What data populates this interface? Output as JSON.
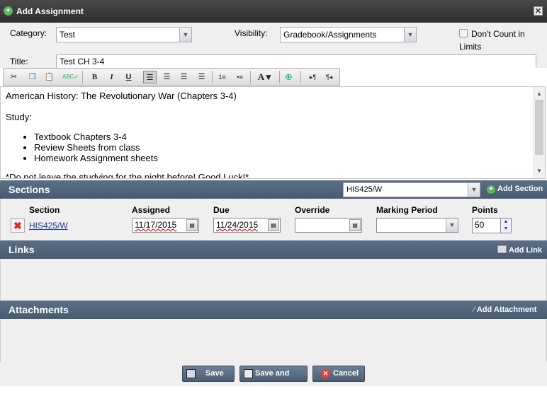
{
  "dialog": {
    "title": "Add Assignment",
    "close_icon": "close-icon"
  },
  "form": {
    "category_label": "Category:",
    "category_value": "Test",
    "visibility_label": "Visibility:",
    "visibility_value": "Gradebook/Assignments",
    "dont_count_label_1": "Don't Count in",
    "dont_count_label_2": "Limits",
    "title_label": "Title:",
    "title_value": "Test CH 3-4"
  },
  "editor": {
    "line1": "American History: The Revolutionary War (Chapters 3-4)",
    "line2": "Study:",
    "bullets": [
      "Textbook Chapters 3-4",
      "Review Sheets from class",
      "Homework Assignment sheets"
    ],
    "line3": "*Do not leave the studying for the night before! Good Luck!*"
  },
  "sections": {
    "header": "Sections",
    "select_value": "HIS425/W",
    "add_label": "Add Section",
    "columns": [
      "Section",
      "Assigned",
      "Due",
      "Override",
      "Marking Period",
      "Points"
    ],
    "row": {
      "section": "HIS425/W",
      "assigned": "11/17/2015",
      "due": "11/24/2015",
      "override": "",
      "marking_period": "",
      "points": "50"
    }
  },
  "links": {
    "header": "Links",
    "add_label": "Add Link"
  },
  "attachments": {
    "header": "Attachments",
    "add_label": "Add Attachment"
  },
  "footer": {
    "save": "Save",
    "save_new": "Save and New",
    "cancel": "Cancel"
  }
}
